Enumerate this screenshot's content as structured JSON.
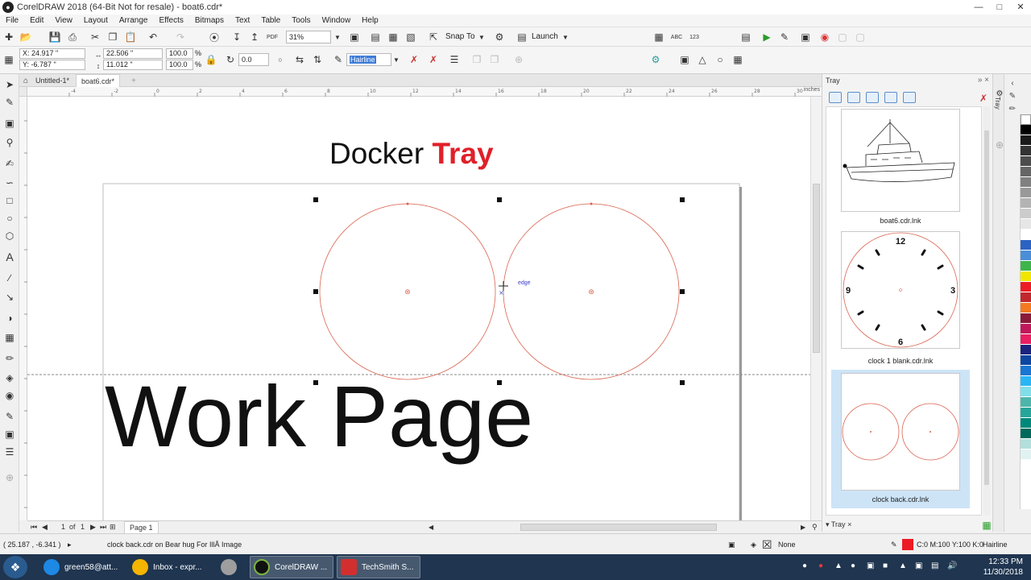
{
  "window": {
    "title": "CorelDRAW 2018 (64-Bit Not for resale) - boat6.cdr*",
    "min": "—",
    "max": "□",
    "close": "✕"
  },
  "menu": [
    "File",
    "Edit",
    "View",
    "Layout",
    "Arrange",
    "Effects",
    "Bitmaps",
    "Text",
    "Table",
    "Tools",
    "Window",
    "Help"
  ],
  "standard_toolbar": {
    "zoom": "31%",
    "snap_to": "Snap To",
    "launch": "Launch"
  },
  "property_bar": {
    "x": "X: 24.917 \"",
    "y": "Y: -6.787 \"",
    "width": "22.506 \"",
    "height": "11.012 \"",
    "scale_w": "100.0",
    "scale_h": "100.0",
    "percent": "%",
    "rotation": "0.0",
    "outline_width": "Hairline"
  },
  "document_tabs": [
    {
      "label": "Untitled-1*"
    },
    {
      "label": "boat6.cdr*"
    }
  ],
  "ruler": {
    "unit": "inches",
    "ticks": [
      "-4",
      "-2",
      "0",
      "2",
      "4",
      "6",
      "8",
      "10",
      "12",
      "14",
      "16",
      "18",
      "20",
      "22",
      "24",
      "26",
      "28",
      "30",
      "32",
      "34",
      "36"
    ]
  },
  "canvas": {
    "heading_black": "Docker",
    "heading_red": "Tray",
    "big_text": "Work Page",
    "snap_label": "edge"
  },
  "page_nav": {
    "current": "1",
    "of": "of",
    "total": "1",
    "page_tab": "Page 1"
  },
  "status": {
    "coords": "( 25.187 , -6.341 )",
    "message": "clock back.cdr on Bear hug For IllÅ Image",
    "fill_label": "None",
    "outline_color": "C:0 M:100 Y:100 K:0",
    "outline_width": "Hairline"
  },
  "docker": {
    "title": "Tray",
    "tab_label": "Tray",
    "side_tab": "Tray",
    "items": [
      {
        "caption": "boat6.cdr.lnk"
      },
      {
        "caption": "clock 1 blank.cdr.lnk",
        "clock_numbers": [
          "12",
          "3",
          "6",
          "9"
        ]
      },
      {
        "caption": "clock back.cdr.lnk"
      }
    ]
  },
  "palette_colors": [
    "#ffffff",
    "#000000",
    "#1a1a1a",
    "#333333",
    "#4d4d4d",
    "#666666",
    "#808080",
    "#999999",
    "#b3b3b3",
    "#cccccc",
    "#e6e6e6",
    "#ffffff",
    "#2b63c4",
    "#4a8ed8",
    "#3db54a",
    "#f2e600",
    "#ed1c24",
    "#c1272d",
    "#f47920",
    "#8b1a3a",
    "#c2185b",
    "#e91e63",
    "#1a237e",
    "#0d47a1",
    "#1976d2",
    "#29b6f6",
    "#80deea",
    "#4db6ac",
    "#26a69a",
    "#00897b",
    "#00695c",
    "#b2dfdb",
    "#e0f2f1"
  ],
  "taskbar": {
    "tasks": [
      {
        "label": "green58@att...",
        "color": "#1e88e5"
      },
      {
        "label": "Inbox - expr...",
        "color": "#f4b400"
      },
      {
        "label": "",
        "color": "#9e9e9e"
      },
      {
        "label": "CorelDRAW ...",
        "color": "#111111"
      },
      {
        "label": "TechSmith S...",
        "color": "#d32f2f"
      }
    ],
    "time": "12:33 PM",
    "date": "11/30/2018"
  }
}
